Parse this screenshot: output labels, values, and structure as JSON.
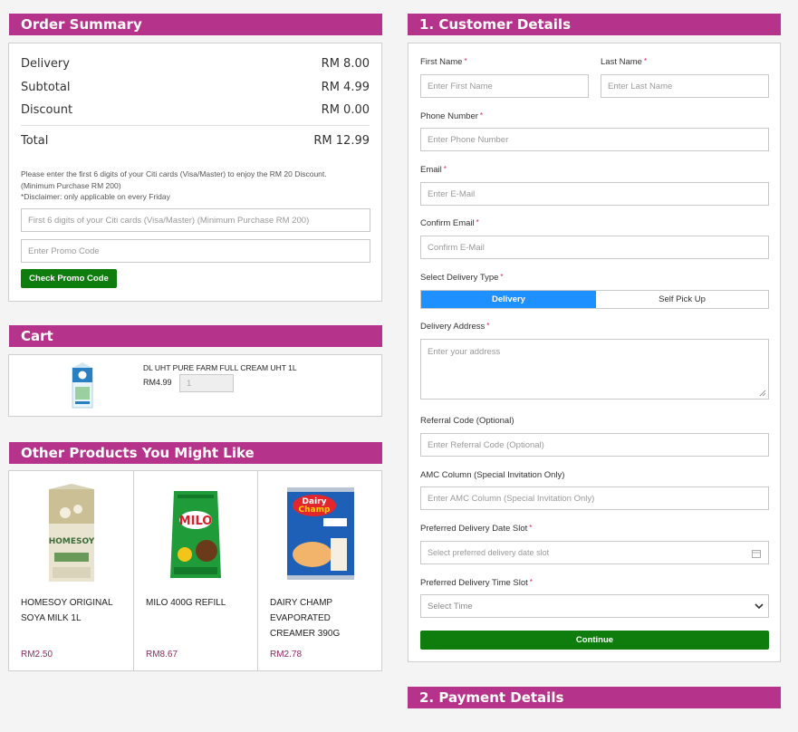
{
  "order_summary": {
    "title": "Order Summary",
    "lines": [
      {
        "label": "Delivery",
        "value": "RM 8.00"
      },
      {
        "label": "Subtotal",
        "value": "RM 4.99"
      },
      {
        "label": "Discount",
        "value": "RM 0.00"
      }
    ],
    "total_label": "Total",
    "total_value": "RM 12.99",
    "note_1": "Please enter the first 6 digits of your Citi cards (Visa/Master) to enjoy the RM 20 Discount.",
    "note_2": "(Minimum Purchase RM 200)",
    "note_3": "*Disclaimer: only applicable on every Friday",
    "citi_placeholder": "First 6 digits of your Citi cards (Visa/Master) (Minimum Purchase RM 200)",
    "promo_placeholder": "Enter Promo Code",
    "check_button": "Check Promo Code"
  },
  "cart": {
    "title": "Cart",
    "item_name": "DL UHT PURE FARM FULL CREAM UHT 1L",
    "item_price": "RM4.99",
    "item_qty": "1"
  },
  "recommendations": {
    "title": "Other Products You Might Like",
    "products": [
      {
        "name": "HOMESOY ORIGINAL SOYA MILK 1L",
        "price": "RM2.50",
        "icon": "soy-milk-carton"
      },
      {
        "name": "MILO 400G REFILL",
        "price": "RM8.67",
        "icon": "milo-refill-pack"
      },
      {
        "name": "DAIRY CHAMP EVAPORATED CREAMER 390G",
        "price": "RM2.78",
        "icon": "creamer-can"
      }
    ]
  },
  "customer": {
    "title": "1. Customer Details",
    "first_name_label": "First Name",
    "first_name_placeholder": "Enter First Name",
    "last_name_label": "Last Name",
    "last_name_placeholder": "Enter Last Name",
    "phone_label": "Phone Number",
    "phone_placeholder": "Enter Phone Number",
    "email_label": "Email",
    "email_placeholder": "Enter E-Mail",
    "confirm_email_label": "Confirm Email",
    "confirm_email_placeholder": "Confirm E-Mail",
    "delivery_type_label": "Select Delivery Type",
    "delivery_option": "Delivery",
    "pickup_option": "Self Pick Up",
    "address_label": "Delivery Address",
    "address_placeholder": "Enter your address",
    "referral_label": "Referral Code (Optional)",
    "referral_placeholder": "Enter Referral Code (Optional)",
    "amc_label": "AMC Column (Special Invitation Only)",
    "amc_placeholder": "Enter AMC Column (Special Invitation Only)",
    "date_label": "Preferred Delivery Date Slot",
    "date_placeholder": "Select preferred delivery date slot",
    "time_label": "Preferred Delivery Time Slot",
    "time_selected": "Select Time",
    "continue_button": "Continue",
    "required_mark": "*"
  },
  "payment": {
    "title": "2. Payment Details"
  },
  "colors": {
    "header": "#b5338a",
    "accent_blue": "#1e90ff",
    "green": "#0e7d0e",
    "price": "#8c2a5e"
  }
}
